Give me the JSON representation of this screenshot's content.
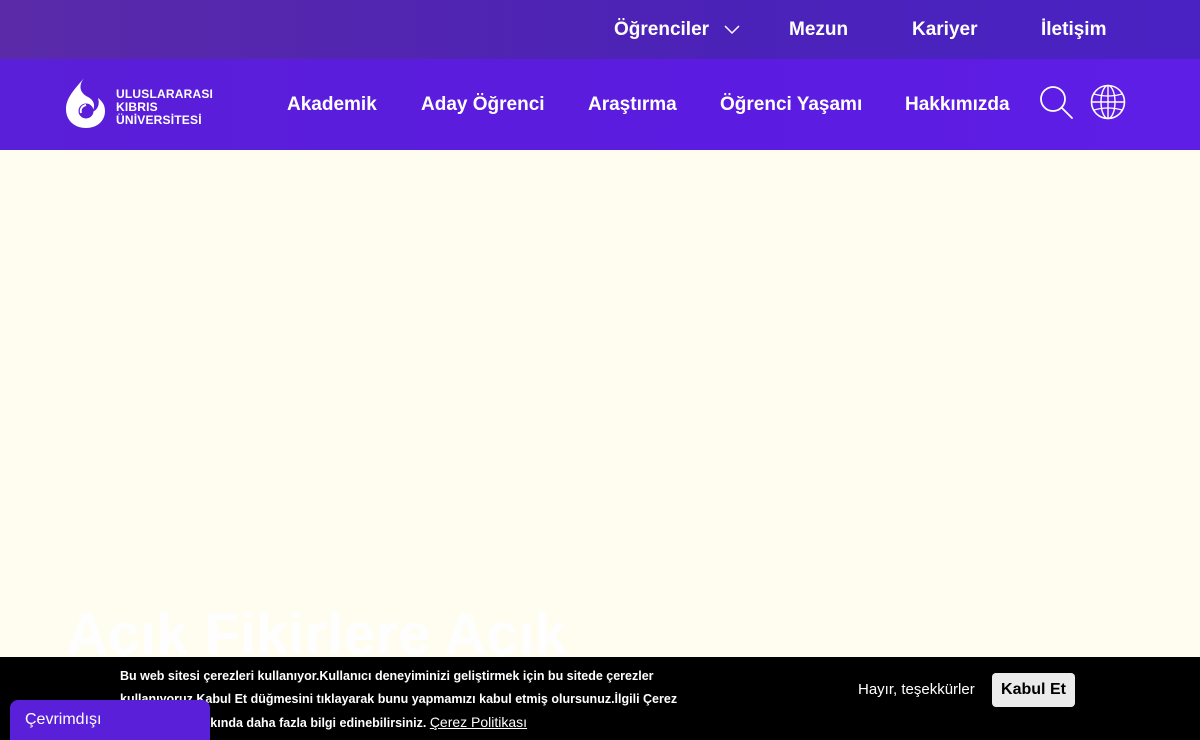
{
  "topbar": {
    "links": [
      "Öğrenciler",
      "Mezun",
      "Kariyer",
      "İletişim"
    ],
    "chevron_icon": "chevron-down-icon"
  },
  "logo": {
    "lines": [
      "ULUSLARARASI",
      "KIBRIS",
      "ÜNİVERSİTESİ"
    ]
  },
  "nav": {
    "links": [
      "Akademik",
      "Aday Öğrenci",
      "Araştırma",
      "Öğrenci Yaşamı",
      "Hakkımızda"
    ],
    "icons": [
      "search-icon",
      "globe-icon"
    ]
  },
  "hero": {
    "title": "Açık Fikirlere Açık"
  },
  "cookie": {
    "text": "Bu web sitesi çerezleri kullanıyor.Kullanıcı deneyiminizi geliştirmek için bu sitede çerezler kullanıyoruz.Kabul Et düğmesini tıklayarak bunu yapmamızı kabul etmiş olursunuz.İlgili Çerez Politikamız hakkında daha fazla bilgi edinebilirsiniz.",
    "policy_link": "Çerez Politikası",
    "decline_label": "Hayır, teşekkürler",
    "accept_label": "Kabul Et"
  },
  "status": {
    "offline_label": "Çevrimdışı"
  },
  "colors": {
    "topbar": "#4b22b8",
    "mainbar": "#5c1be0",
    "hero_bg": "#fefdf0",
    "cookie_bg": "#000000"
  }
}
